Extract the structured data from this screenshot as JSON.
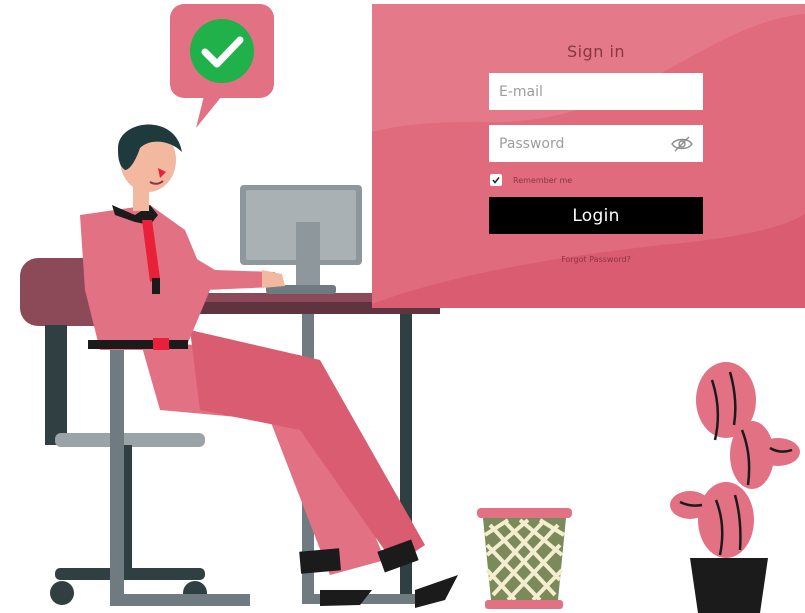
{
  "signin": {
    "title": "Sign in",
    "email_placeholder": "E-mail",
    "password_placeholder": "Password",
    "remember_label": "Remember me",
    "remember_checked": true,
    "login_label": "Login",
    "forgot_label": "Forgot Password?"
  },
  "icons": {
    "password_toggle": "eye-slash-icon",
    "remember": "checkmark-icon",
    "success": "checkmark-badge-icon"
  },
  "colors": {
    "panel": "#df6b7c",
    "panel_dark": "#d95c70",
    "login_button": "#000000",
    "success_badge": "#21b14a",
    "speech_bubble": "#e27184"
  }
}
